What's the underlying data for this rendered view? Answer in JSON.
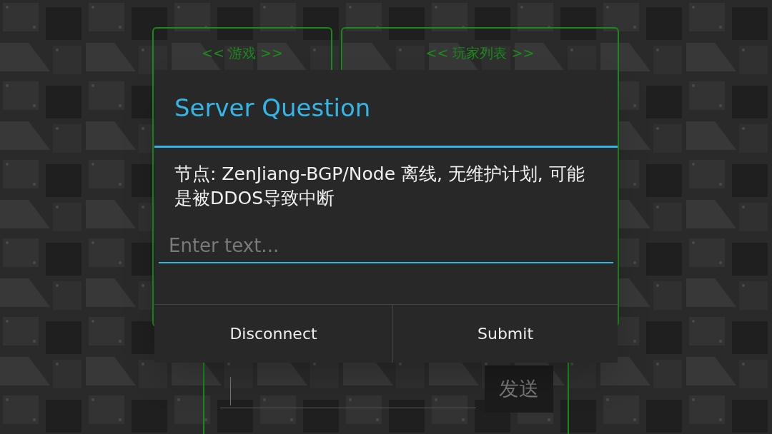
{
  "game_ui": {
    "panels": [
      {
        "title": "<< 游戏 >>"
      },
      {
        "title": "<< 玩家列表 >>"
      }
    ],
    "chat": {
      "send_button": "发送"
    }
  },
  "dialog": {
    "title": "Server Question",
    "message": "节点: ZenJiang-BGP/Node 离线, 无维护计划, 可能是被DDOS导致中断",
    "input": {
      "placeholder": "Enter text..."
    },
    "buttons": [
      "Disconnect",
      "Submit"
    ]
  }
}
